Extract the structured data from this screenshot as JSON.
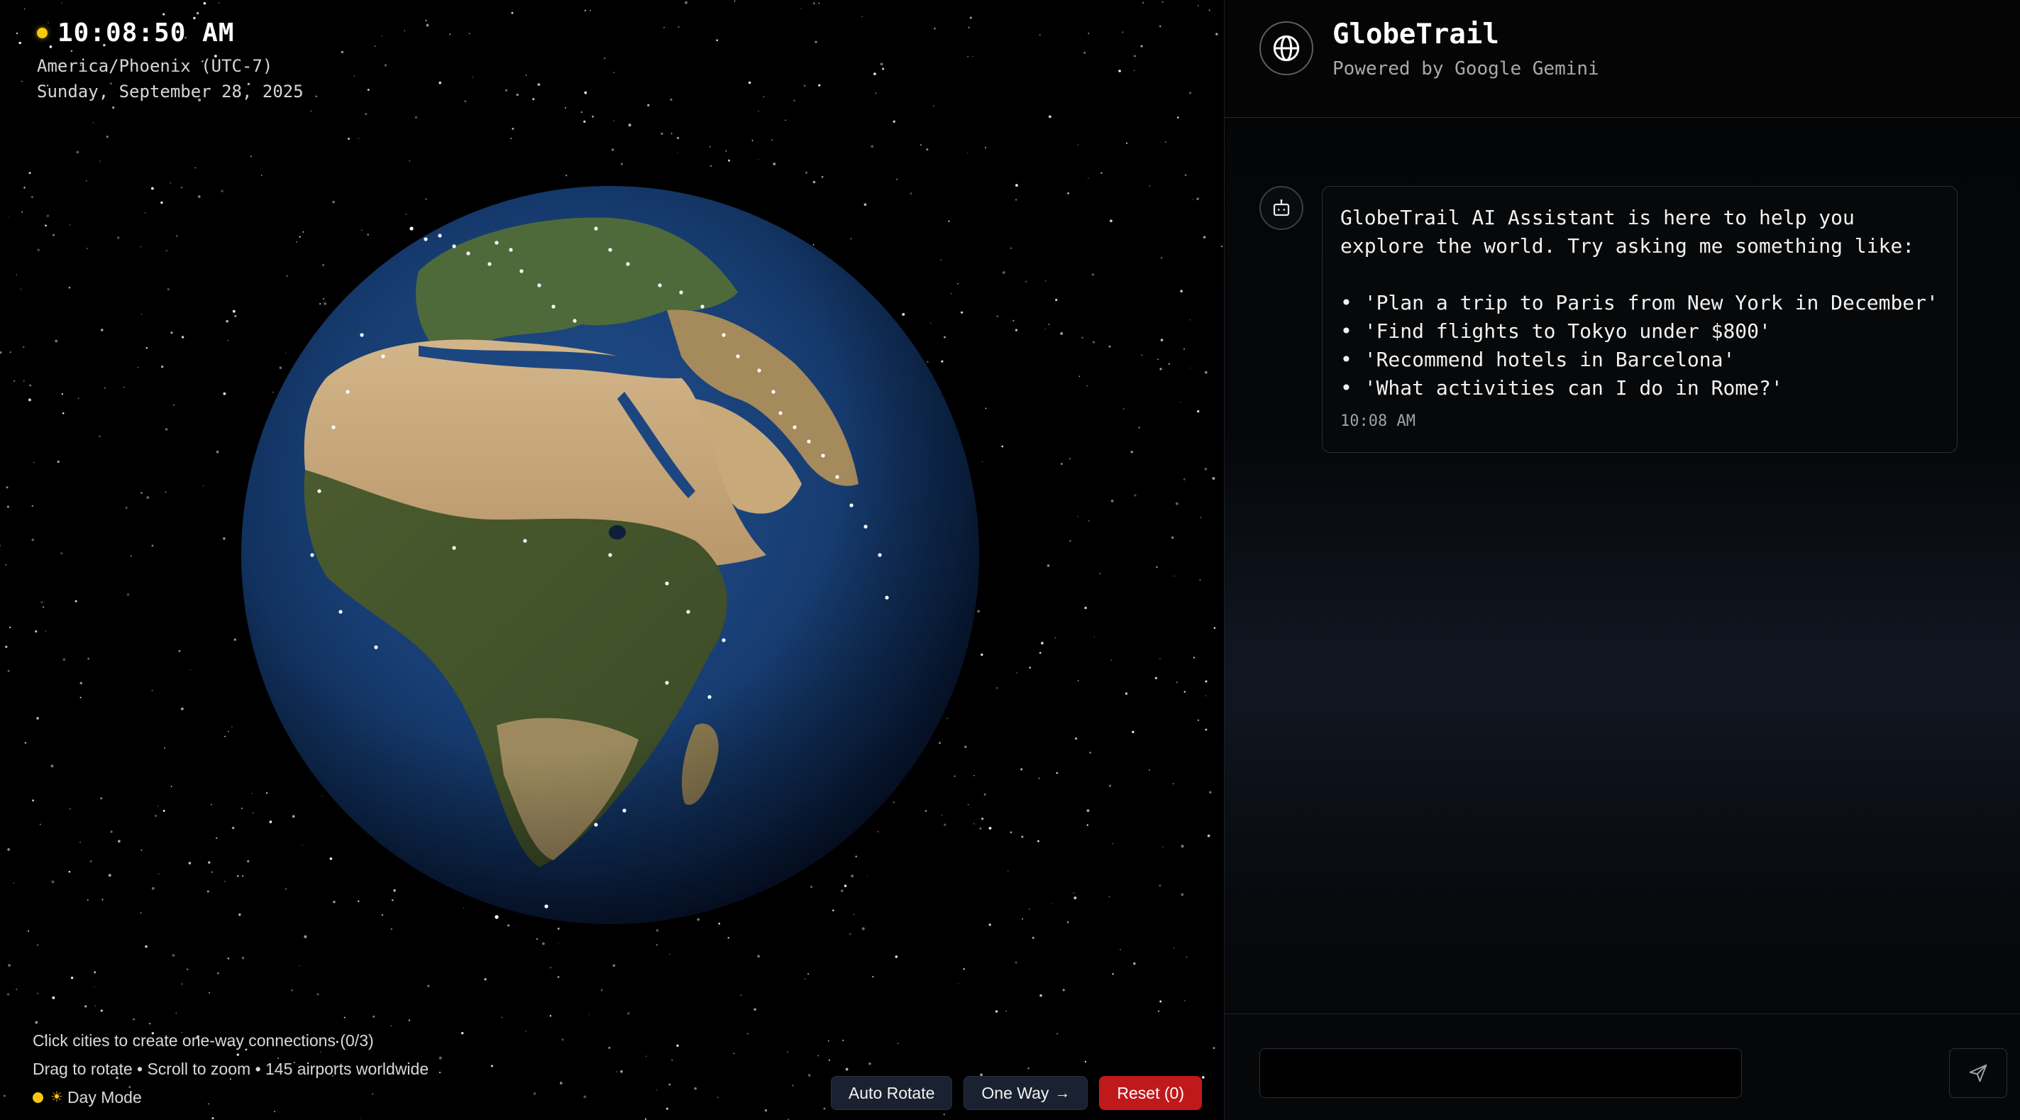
{
  "clock": {
    "time": "10:08:50 AM",
    "timezone": "America/Phoenix (UTC-7)",
    "date": "Sunday, September 28, 2025",
    "status_color": "#f6c90e"
  },
  "hints": {
    "line1": "Click cities to create one-way connections (0/3)",
    "line2": "Drag to rotate • Scroll to zoom • 145 airports worldwide",
    "mode_label": "Day Mode",
    "mode_icon": "sun-icon"
  },
  "controls": {
    "auto_rotate": "Auto Rotate",
    "one_way": "One Way",
    "one_way_icon": "arrow-right-icon",
    "reset": "Reset (0)",
    "danger_color": "#c0191c"
  },
  "header": {
    "logo_icon": "globe-icon",
    "title": "GlobeTrail",
    "subtitle": "Powered by Google Gemini"
  },
  "chat": {
    "avatar_icon": "bot-icon",
    "messages": [
      {
        "intro": "GlobeTrail AI Assistant is here to help you explore the world. Try asking me something like:",
        "suggestions": [
          "• 'Plan a trip to Paris from New York in December'",
          "• 'Find flights to Tokyo under $800'",
          "• 'Recommend hotels in Barcelona'",
          "• 'What activities can I do in Rome?'"
        ],
        "time": "10:08 AM"
      }
    ]
  },
  "composer": {
    "value": "",
    "placeholder": "",
    "send_icon": "send-icon"
  }
}
